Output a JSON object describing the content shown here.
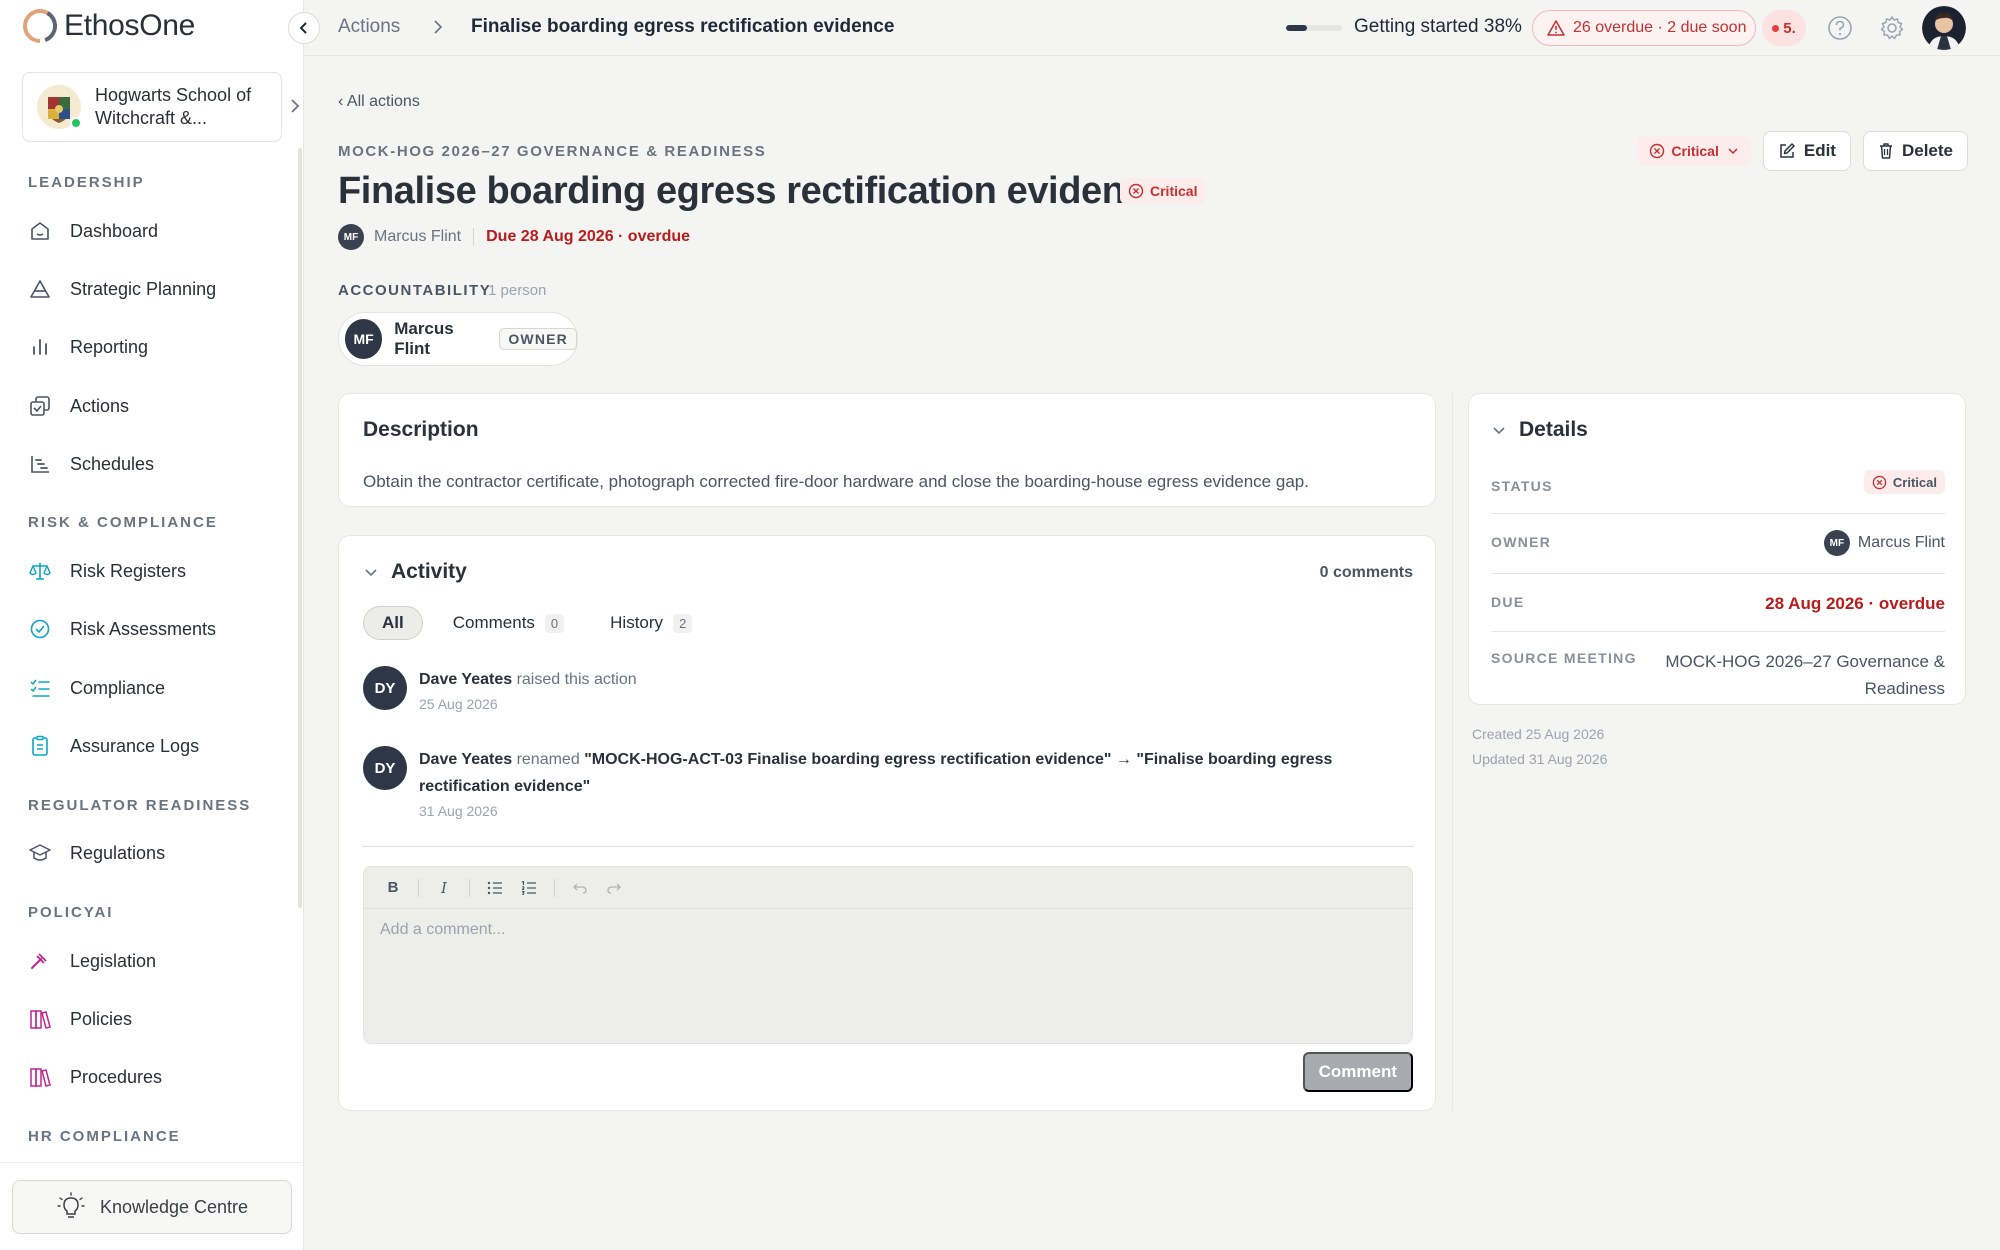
{
  "app": {
    "brand": "EthosOne"
  },
  "org": {
    "name": "Hogwarts School of Witchcraft &..."
  },
  "sidebar": {
    "sections": [
      {
        "title": "LEADERSHIP",
        "items": [
          "Dashboard",
          "Strategic Planning",
          "Reporting",
          "Actions",
          "Schedules"
        ]
      },
      {
        "title": "RISK & COMPLIANCE",
        "items": [
          "Risk Registers",
          "Risk Assessments",
          "Compliance",
          "Assurance Logs"
        ]
      },
      {
        "title": "REGULATOR READINESS",
        "items": [
          "Regulations"
        ]
      },
      {
        "title": "POLICYAI",
        "items": [
          "Legislation",
          "Policies",
          "Procedures"
        ]
      },
      {
        "title": "HR COMPLIANCE",
        "items": []
      }
    ],
    "knowledge_centre": "Knowledge Centre"
  },
  "topbar": {
    "breadcrumb_parent": "Actions",
    "breadcrumb_current": "Finalise boarding egress rectification evidence",
    "getting_started_label": "Getting started 38%",
    "getting_started_progress": 0.38,
    "overdue_label": "26 overdue · 2 due soon",
    "notifications_label": "5."
  },
  "action": {
    "back_link": "All actions",
    "eyebrow": "MOCK-HOG 2026–27 GOVERNANCE & READINESS",
    "title": "Finalise boarding egress rectification evidence",
    "severity": "Critical",
    "owner_initials": "MF",
    "owner_name": "Marcus Flint",
    "due_label": "Due 28 Aug 2026 · overdue",
    "edit_label": "Edit",
    "delete_label": "Delete"
  },
  "accountability": {
    "label": "ACCOUNTABILITY",
    "count": "1 person",
    "person_initials": "MF",
    "person_name": "Marcus Flint",
    "role": "OWNER"
  },
  "description": {
    "title": "Description",
    "text": "Obtain the contractor certificate, photograph corrected fire-door hardware and close the boarding-house egress evidence gap."
  },
  "activity": {
    "title": "Activity",
    "comment_count": "0 comments",
    "tabs": [
      {
        "label": "All",
        "count": ""
      },
      {
        "label": "Comments",
        "count": "0"
      },
      {
        "label": "History",
        "count": "2"
      }
    ],
    "items": [
      {
        "initials": "DY",
        "author": "Dave Yeates",
        "verb": "raised this action",
        "detail": "",
        "date": "25 Aug 2026"
      },
      {
        "initials": "DY",
        "author": "Dave Yeates",
        "verb": "renamed",
        "detail": "\"MOCK-HOG-ACT-03 Finalise boarding egress rectification evidence\" → \"Finalise boarding egress rectification evidence\"",
        "date": "31 Aug 2026"
      }
    ],
    "editor_placeholder": "Add a comment...",
    "comment_button": "Comment"
  },
  "details": {
    "title": "Details",
    "status_key": "STATUS",
    "status_value": "Critical",
    "owner_key": "OWNER",
    "owner_initials": "MF",
    "owner_value": "Marcus Flint",
    "due_key": "DUE",
    "due_value": "28 Aug 2026 · overdue",
    "source_key": "SOURCE MEETING",
    "source_value": "MOCK-HOG 2026–27 Governance & Readiness",
    "created": "Created 25 Aug 2026",
    "updated": "Updated 31 Aug 2026"
  },
  "colors": {
    "critical": "#c53030",
    "avatar_dark": "#2d3748",
    "risk_icon": "#0ea5c6",
    "policy_icon": "#c0268f"
  }
}
